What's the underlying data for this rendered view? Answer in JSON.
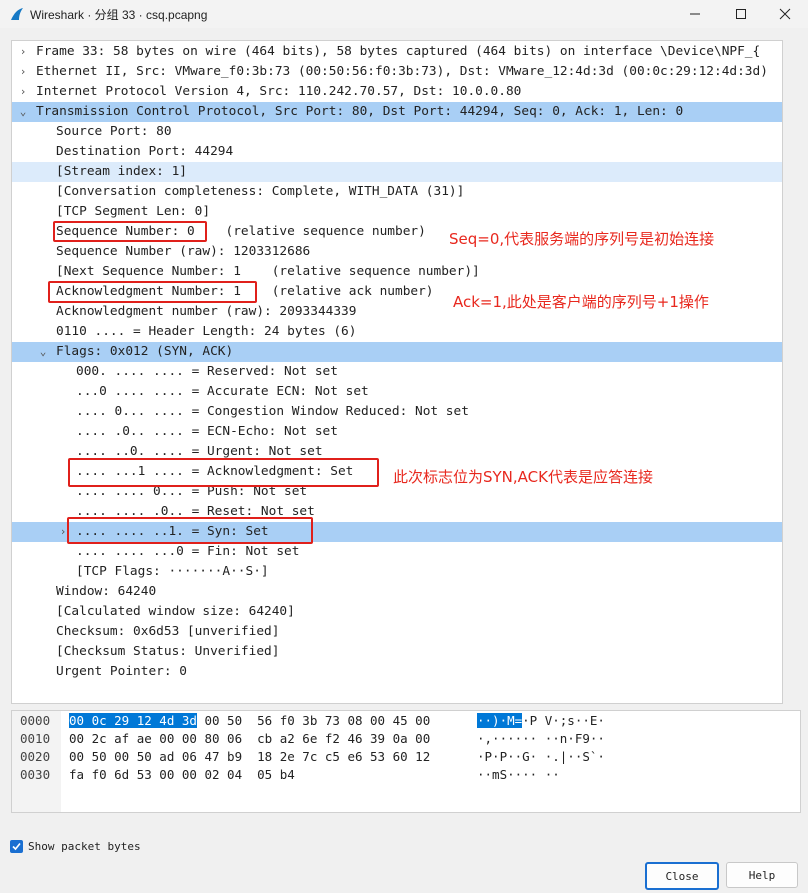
{
  "window": {
    "title": "Wireshark · 分组 33 · csq.pcapng"
  },
  "tree": [
    {
      "text": "Frame 33: 58 bytes on wire (464 bits), 58 bytes captured (464 bits) on interface \\Device\\NPF_{",
      "level": 0,
      "expander": ">"
    },
    {
      "text": "Ethernet II, Src: VMware_f0:3b:73 (00:50:56:f0:3b:73), Dst: VMware_12:4d:3d (00:0c:29:12:4d:3d)",
      "level": 0,
      "expander": ">"
    },
    {
      "text": "Internet Protocol Version 4, Src: 110.242.70.57, Dst: 10.0.0.80",
      "level": 0,
      "expander": ">"
    },
    {
      "text": "Transmission Control Protocol, Src Port: 80, Dst Port: 44294, Seq: 0, Ack: 1, Len: 0",
      "level": 0,
      "expander": "v",
      "highlight": "strong"
    },
    {
      "text": "Source Port: 80",
      "level": 1
    },
    {
      "text": "Destination Port: 44294",
      "level": 1
    },
    {
      "text": "[Stream index: 1]",
      "level": 1,
      "highlight": "light"
    },
    {
      "text": "[Conversation completeness: Complete, WITH_DATA (31)]",
      "level": 1
    },
    {
      "text": "[TCP Segment Len: 0]",
      "level": 1
    },
    {
      "text": "Sequence Number: 0    (relative sequence number)",
      "level": 1
    },
    {
      "text": "Sequence Number (raw): 1203312686",
      "level": 1
    },
    {
      "text": "[Next Sequence Number: 1    (relative sequence number)]",
      "level": 1
    },
    {
      "text": "Acknowledgment Number: 1    (relative ack number)",
      "level": 1
    },
    {
      "text": "Acknowledgment number (raw): 2093344339",
      "level": 1
    },
    {
      "text": "0110 .... = Header Length: 24 bytes (6)",
      "level": 1
    },
    {
      "text": "Flags: 0x012 (SYN, ACK)",
      "level": 1,
      "expander": "v",
      "highlight": "strong"
    },
    {
      "text": "000. .... .... = Reserved: Not set",
      "level": 2
    },
    {
      "text": "...0 .... .... = Accurate ECN: Not set",
      "level": 2
    },
    {
      "text": ".... 0... .... = Congestion Window Reduced: Not set",
      "level": 2
    },
    {
      "text": ".... .0.. .... = ECN-Echo: Not set",
      "level": 2
    },
    {
      "text": ".... ..0. .... = Urgent: Not set",
      "level": 2
    },
    {
      "text": ".... ...1 .... = Acknowledgment: Set",
      "level": 2
    },
    {
      "text": ".... .... 0... = Push: Not set",
      "level": 2
    },
    {
      "text": ".... .... .0.. = Reset: Not set",
      "level": 2
    },
    {
      "text": ".... .... ..1. = Syn: Set",
      "level": 2,
      "expander": ">",
      "highlight": "strong"
    },
    {
      "text": ".... .... ...0 = Fin: Not set",
      "level": 2
    },
    {
      "text": "[TCP Flags: ·······A··S·]",
      "level": 2
    },
    {
      "text": "Window: 64240",
      "level": 1
    },
    {
      "text": "[Calculated window size: 64240]",
      "level": 1
    },
    {
      "text": "Checksum: 0x6d53 [unverified]",
      "level": 1
    },
    {
      "text": "[Checksum Status: Unverified]",
      "level": 1
    },
    {
      "text": "Urgent Pointer: 0",
      "level": 1
    }
  ],
  "annotations": [
    {
      "text": "Seq=0,代表服务端的序列号是初始连接"
    },
    {
      "text": "Ack=1,此处是客户端的序列号+1操作"
    },
    {
      "text": "此次标志位为SYN,ACK代表是应答连接"
    }
  ],
  "bytes": [
    {
      "offset": "0000",
      "sel_hex": "00 0c 29 12 4d 3d",
      "hex": " 00 50  56 f0 3b 73 08 00 45 00",
      "sel_ascii": "··)·M=",
      "ascii": "·P V·;s··E·"
    },
    {
      "offset": "0010",
      "sel_hex": "",
      "hex": "00 2c af ae 00 00 80 06  cb a2 6e f2 46 39 0a 00",
      "sel_ascii": "",
      "ascii": "·,······ ··n·F9··"
    },
    {
      "offset": "0020",
      "sel_hex": "",
      "hex": "00 50 00 50 ad 06 47 b9  18 2e 7c c5 e6 53 60 12",
      "sel_ascii": "",
      "ascii": "·P·P··G· ·.|··S`·"
    },
    {
      "offset": "0030",
      "sel_hex": "",
      "hex": "fa f0 6d 53 00 00 02 04  05 b4",
      "sel_ascii": "",
      "ascii": "··mS···· ··"
    }
  ],
  "footer": {
    "show_bytes_label": "Show packet bytes",
    "show_bytes_checked": true,
    "close_label": "Close",
    "help_label": "Help"
  }
}
